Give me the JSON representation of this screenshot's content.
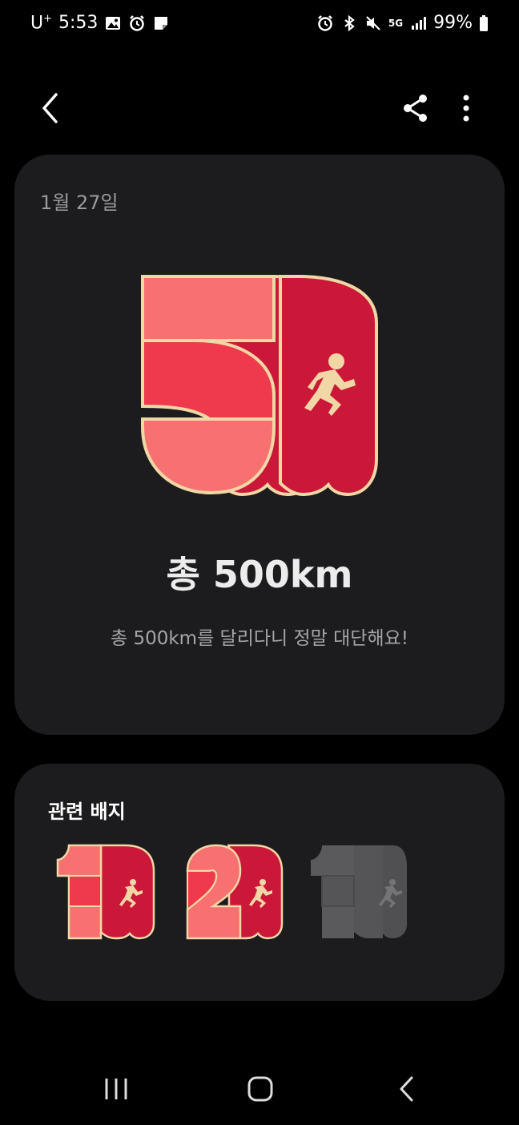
{
  "status": {
    "carrier": "U",
    "carrier_sup": "+",
    "time": "5:53",
    "network": "5G",
    "battery": "99%"
  },
  "card": {
    "date": "1월 27일",
    "badge_icon": "500km-running-badge",
    "title": "총 500km",
    "description": "총 500km를 달리다니 정말 대단해요!"
  },
  "related": {
    "title": "관련 배지",
    "badges": [
      {
        "icon": "100km-running-badge",
        "state": "earned"
      },
      {
        "icon": "200km-running-badge",
        "state": "earned"
      },
      {
        "icon": "1000km-running-badge",
        "state": "locked"
      }
    ]
  },
  "colors": {
    "background": "#000000",
    "card": "#1c1c1e",
    "badge_light": "#f87171",
    "badge_mid": "#ee3a4c",
    "badge_dark": "#cb1839",
    "badge_rim": "#f2d7a6",
    "locked": "#5a5a5c"
  }
}
